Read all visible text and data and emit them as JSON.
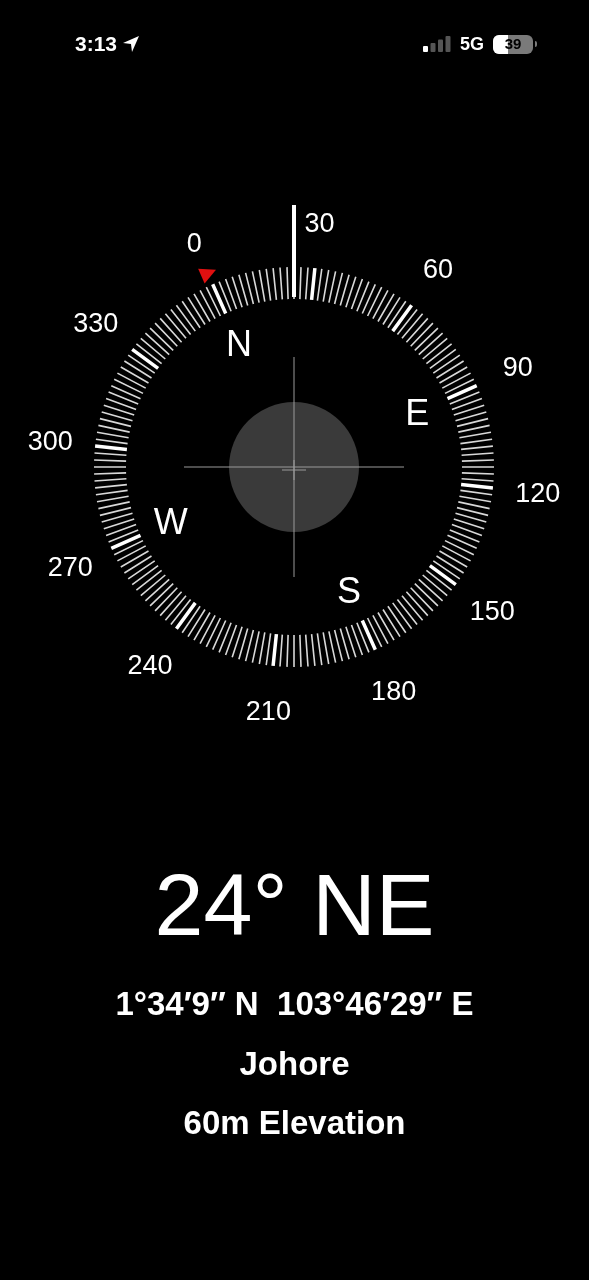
{
  "status_bar": {
    "time": "3:13",
    "network": "5G",
    "battery": "39"
  },
  "compass": {
    "degree_labels": [
      "0",
      "30",
      "60",
      "90",
      "120",
      "150",
      "180",
      "210",
      "240",
      "270",
      "300",
      "330"
    ],
    "cardinal_labels": [
      "N",
      "E",
      "S",
      "W"
    ]
  },
  "heading": "24° NE",
  "coordinates": "1°34′9″ N  103°46′29″ E",
  "place": "Johore",
  "elevation": "60m Elevation"
}
